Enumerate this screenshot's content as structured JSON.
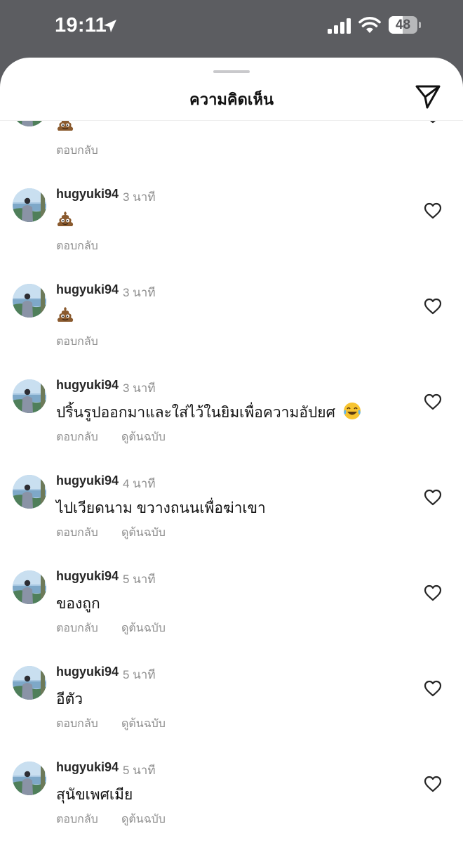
{
  "status_bar": {
    "time": "19:11",
    "battery": "48",
    "battery_level_percent": 48
  },
  "header": {
    "title": "ความคิดเห็น"
  },
  "icons": {
    "location": "location-arrow-icon",
    "signal": "cellular-signal-icon",
    "wifi": "wifi-icon",
    "battery": "battery-icon",
    "send": "send-icon",
    "like": "heart-outline-icon",
    "poop": "pile-of-poo-emoji",
    "laugh": "face-with-tears-of-joy-emoji"
  },
  "actions": {
    "reply": "ตอบกลับ",
    "see_translation": "ดูต้นฉบับ"
  },
  "comments": [
    {
      "username": "",
      "time": "",
      "text": "💩",
      "has_translation": false
    },
    {
      "username": "hugyuki94",
      "time": "3 นาที",
      "text": "💩",
      "has_translation": false
    },
    {
      "username": "hugyuki94",
      "time": "3 นาที",
      "text": "💩",
      "has_translation": false
    },
    {
      "username": "hugyuki94",
      "time": "3 นาที",
      "text": "ปริ้นรูปออกมาและใส่ไว้ในยิมเพื่อความอัปยศ 😂",
      "has_translation": true
    },
    {
      "username": "hugyuki94",
      "time": "4 นาที",
      "text": "ไปเวียดนาม ขวางถนนเพื่อฆ่าเขา",
      "has_translation": true
    },
    {
      "username": "hugyuki94",
      "time": "5 นาที",
      "text": "ของถูก",
      "has_translation": true
    },
    {
      "username": "hugyuki94",
      "time": "5 นาที",
      "text": "อีตัว",
      "has_translation": true
    },
    {
      "username": "hugyuki94",
      "time": "5 นาที",
      "text": "สุนัขเพศเมีย",
      "has_translation": true
    }
  ],
  "colors": {
    "status_bar_bg": "#5c5d61",
    "sheet_bg": "#ffffff",
    "username": "#262626",
    "meta": "#8e8e8e"
  }
}
